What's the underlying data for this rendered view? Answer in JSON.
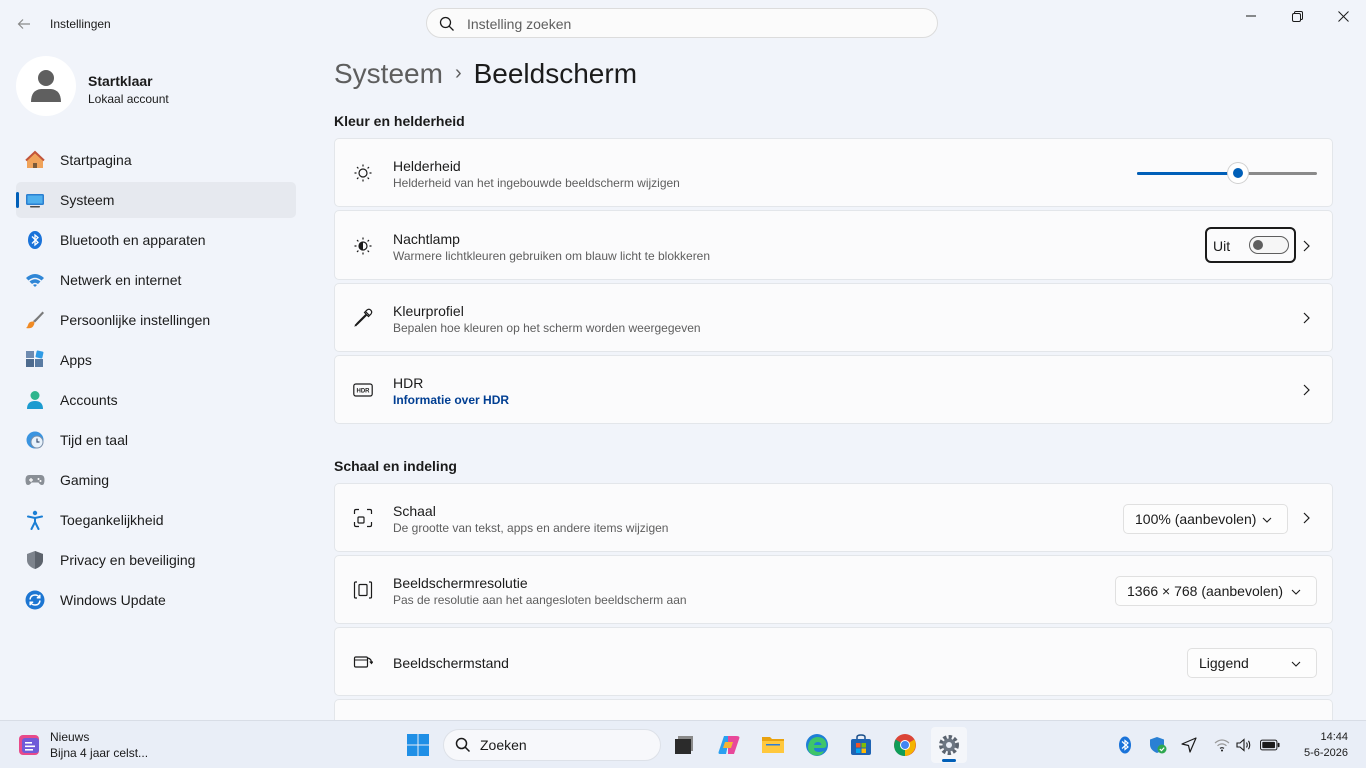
{
  "window": {
    "title": "Instellingen",
    "search_placeholder": "Instelling zoeken"
  },
  "profile": {
    "name": "Startklaar",
    "account_type": "Lokaal account"
  },
  "sidebar": {
    "items": [
      {
        "label": "Startpagina",
        "icon": "home-icon"
      },
      {
        "label": "Systeem",
        "icon": "system-icon",
        "active": true
      },
      {
        "label": "Bluetooth en apparaten",
        "icon": "bluetooth-icon"
      },
      {
        "label": "Netwerk en internet",
        "icon": "wifi-icon"
      },
      {
        "label": "Persoonlijke instellingen",
        "icon": "brush-icon"
      },
      {
        "label": "Apps",
        "icon": "apps-icon"
      },
      {
        "label": "Accounts",
        "icon": "accounts-icon"
      },
      {
        "label": "Tijd en taal",
        "icon": "clock-globe-icon"
      },
      {
        "label": "Gaming",
        "icon": "gamepad-icon"
      },
      {
        "label": "Toegankelijkheid",
        "icon": "accessibility-icon"
      },
      {
        "label": "Privacy en beveiliging",
        "icon": "shield-icon"
      },
      {
        "label": "Windows Update",
        "icon": "update-icon"
      }
    ]
  },
  "breadcrumb": {
    "parent": "Systeem",
    "separator": "›",
    "current": "Beeldscherm"
  },
  "sections": {
    "color": {
      "title": "Kleur en helderheid",
      "brightness": {
        "title": "Helderheid",
        "desc": "Helderheid van het ingebouwde beeldscherm wijzigen",
        "value_percent": 56
      },
      "nightlight": {
        "title": "Nachtlamp",
        "desc": "Warmere lichtkleuren gebruiken om blauw licht te blokkeren",
        "state_label": "Uit"
      },
      "colorprofile": {
        "title": "Kleurprofiel",
        "desc": "Bepalen hoe kleuren op het scherm worden weergegeven"
      },
      "hdr": {
        "title": "HDR",
        "link": "Informatie over HDR"
      }
    },
    "scale": {
      "title": "Schaal en indeling",
      "scale": {
        "title": "Schaal",
        "desc": "De grootte van tekst, apps en andere items wijzigen",
        "value": "100% (aanbevolen)"
      },
      "resolution": {
        "title": "Beeldschermresolutie",
        "desc": "Pas de resolutie aan het aangesloten beeldscherm aan",
        "value": "1366 × 768 (aanbevolen)"
      },
      "orientation": {
        "title": "Beeldschermstand",
        "value": "Liggend"
      }
    }
  },
  "taskbar": {
    "news_title": "Nieuws",
    "news_subtitle": "Bijna 4 jaar celst...",
    "search_label": "Zoeken",
    "time": "14:44",
    "date": "5-6-2026"
  },
  "colors": {
    "accent": "#005fb8",
    "link": "#003e92"
  }
}
